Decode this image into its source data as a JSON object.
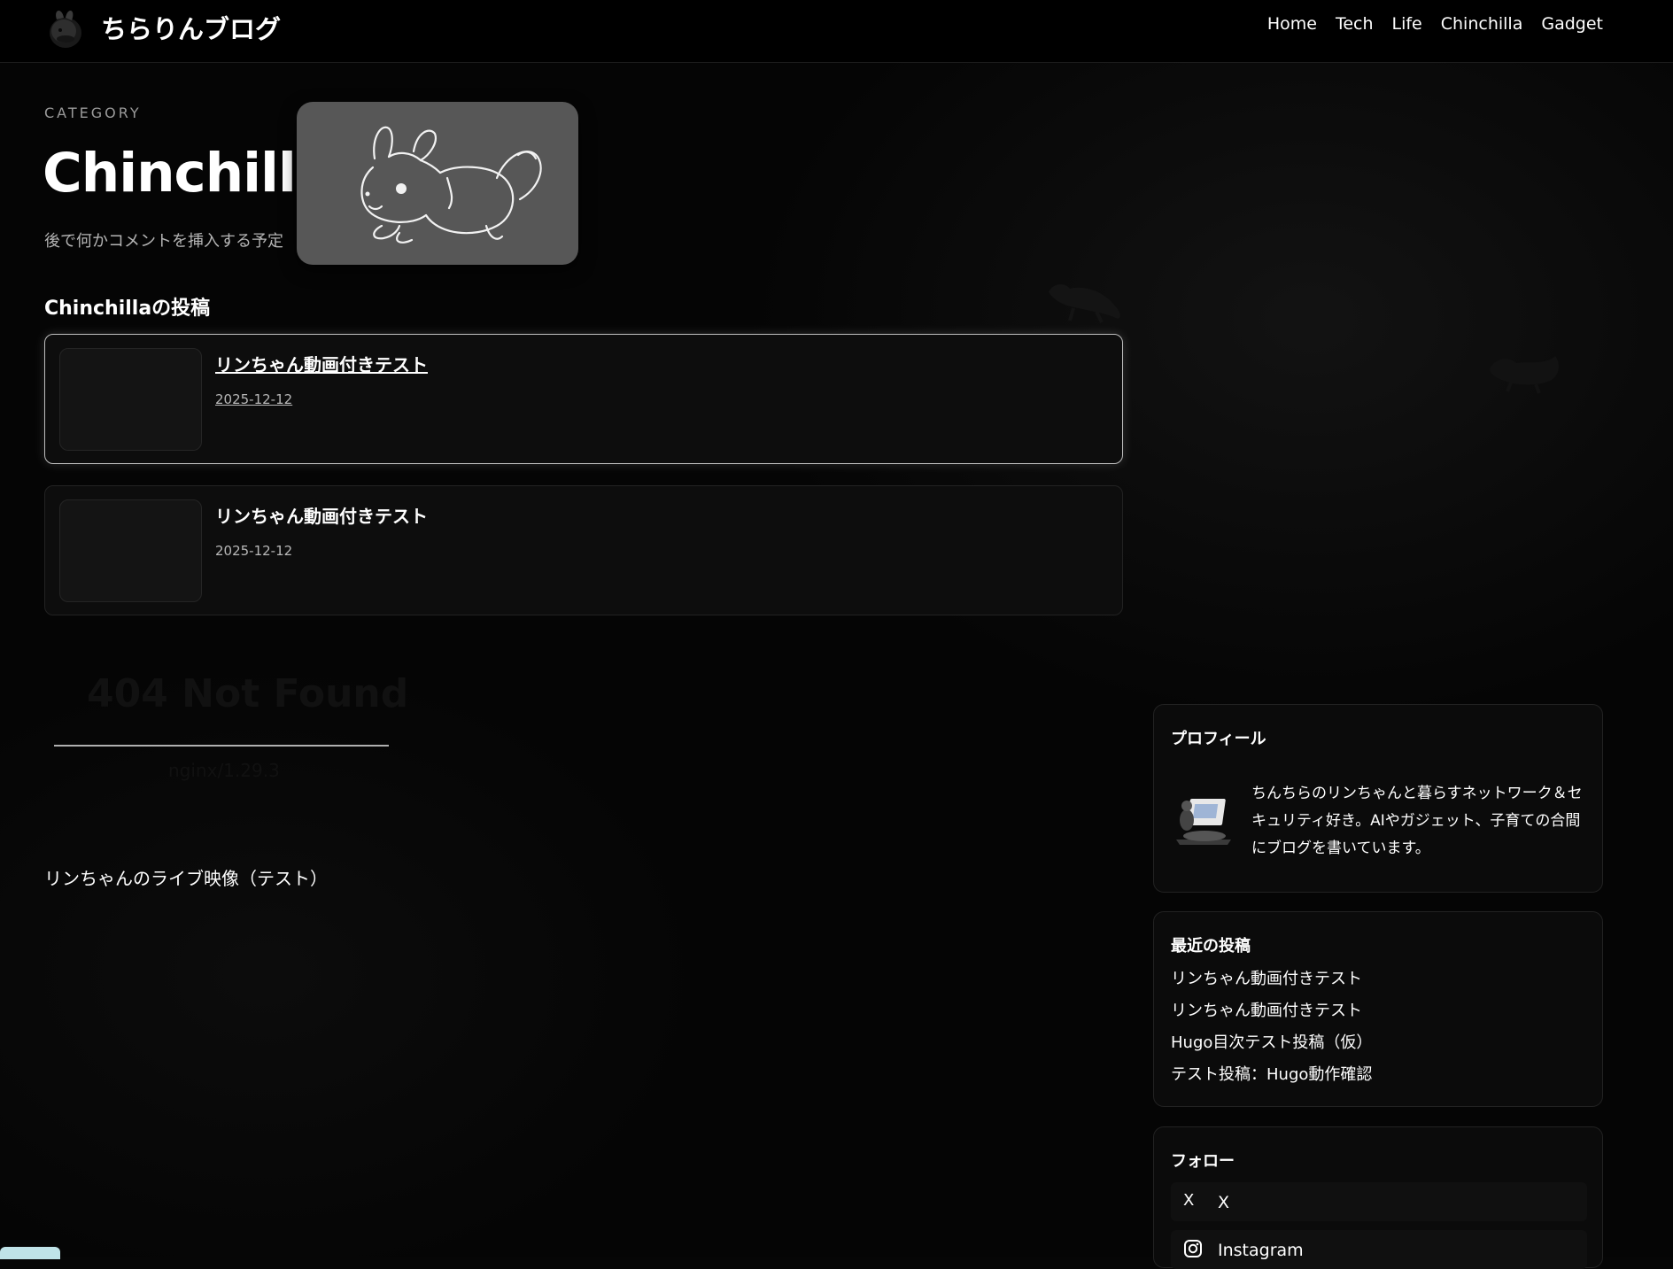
{
  "header": {
    "site_title": "ちらりんブログ",
    "nav": [
      "Home",
      "Tech",
      "Life",
      "Chinchilla",
      "Gadget"
    ]
  },
  "category": {
    "label": "CATEGORY",
    "title": "Chinchilla",
    "description": "後で何かコメントを挿入する予定"
  },
  "posts": {
    "heading": "Chinchillaの投稿",
    "items": [
      {
        "title": "リンちゃん動画付きテスト",
        "date": "2025-12-12"
      },
      {
        "title": "リンちゃん動画付きテスト",
        "date": "2025-12-12"
      }
    ]
  },
  "embed_error": {
    "title": "404 Not Found",
    "server": "nginx/1.29.3"
  },
  "live": {
    "caption": "リンちゃんのライブ映像（テスト）"
  },
  "sidebar": {
    "profile": {
      "title": "プロフィール",
      "text": "ちんちらのリンちゃんと暮らすネットワーク＆セキュリティ好き。AIやガジェット、子育ての合間にブログを書いています。"
    },
    "recent": {
      "title": "最近の投稿",
      "items": [
        "リンちゃん動画付きテスト",
        "リンちゃん動画付きテスト",
        "Hugo目次テスト投稿（仮）",
        "テスト投稿：Hugo動作確認"
      ]
    },
    "follow": {
      "title": "フォロー",
      "items": [
        {
          "icon_glyph": "X",
          "label": "X"
        },
        {
          "icon_glyph": "",
          "label": "Instagram"
        }
      ]
    }
  },
  "colors": {
    "background": "#060606",
    "card": "#0d0d0d",
    "text": "#ffffff",
    "muted": "#b5b5b5"
  }
}
